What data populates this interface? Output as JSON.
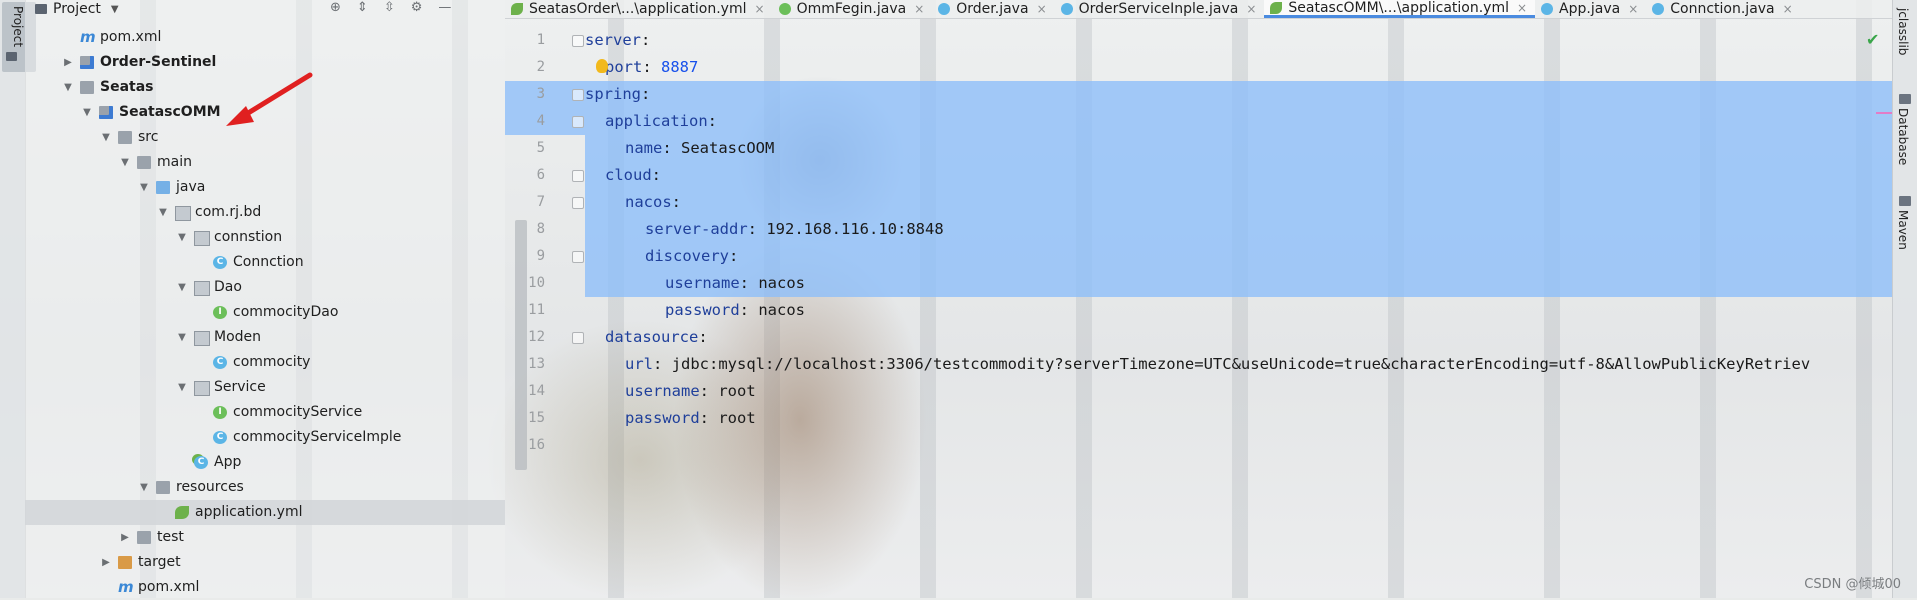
{
  "left_strip": {
    "project_tab": "Project"
  },
  "project": {
    "title": "Project",
    "tree": [
      {
        "label": "pom.xml",
        "icon": "maven-icon",
        "indent": 1,
        "arrow": "",
        "bold": false
      },
      {
        "label": "Order-Sentinel",
        "icon": "module-icon",
        "indent": 1,
        "arrow": "▶",
        "bold": true
      },
      {
        "label": "Seatas",
        "icon": "folder-icon",
        "indent": 1,
        "arrow": "▼",
        "bold": true
      },
      {
        "label": "SeatascOMM",
        "icon": "module-icon",
        "indent": 2,
        "arrow": "▼",
        "bold": true
      },
      {
        "label": "src",
        "icon": "folder-icon",
        "indent": 3,
        "arrow": "▼",
        "bold": false
      },
      {
        "label": "main",
        "icon": "folder-icon",
        "indent": 4,
        "arrow": "▼",
        "bold": false
      },
      {
        "label": "java",
        "icon": "folder-blue-icon",
        "indent": 5,
        "arrow": "▼",
        "bold": false
      },
      {
        "label": "com.rj.bd",
        "icon": "package-icon",
        "indent": 6,
        "arrow": "▼",
        "bold": false
      },
      {
        "label": "connstion",
        "icon": "package-icon",
        "indent": 7,
        "arrow": "▼",
        "bold": false
      },
      {
        "label": "Connction",
        "icon": "class-icon",
        "indent": 8,
        "arrow": "",
        "bold": false
      },
      {
        "label": "Dao",
        "icon": "package-icon",
        "indent": 7,
        "arrow": "▼",
        "bold": false
      },
      {
        "label": "commocityDao",
        "icon": "interface-icon",
        "indent": 8,
        "arrow": "",
        "bold": false
      },
      {
        "label": "Moden",
        "icon": "package-icon",
        "indent": 7,
        "arrow": "▼",
        "bold": false
      },
      {
        "label": "commocity",
        "icon": "class-icon",
        "indent": 8,
        "arrow": "",
        "bold": false
      },
      {
        "label": "Service",
        "icon": "package-icon",
        "indent": 7,
        "arrow": "▼",
        "bold": false
      },
      {
        "label": "commocityService",
        "icon": "interface-icon",
        "indent": 8,
        "arrow": "",
        "bold": false
      },
      {
        "label": "commocityServiceImple",
        "icon": "class-icon",
        "indent": 8,
        "arrow": "",
        "bold": false
      },
      {
        "label": "App",
        "icon": "app-icon",
        "indent": 7,
        "arrow": "",
        "bold": false
      },
      {
        "label": "resources",
        "icon": "folder-icon",
        "indent": 5,
        "arrow": "▼",
        "bold": false
      },
      {
        "label": "application.yml",
        "icon": "yml-icon",
        "indent": 6,
        "arrow": "",
        "bold": false,
        "selected": true
      },
      {
        "label": "test",
        "icon": "folder-icon",
        "indent": 4,
        "arrow": "▶",
        "bold": false
      },
      {
        "label": "target",
        "icon": "folder-orange-icon",
        "indent": 3,
        "arrow": "▶",
        "bold": false
      },
      {
        "label": "pom.xml",
        "icon": "maven-icon",
        "indent": 3,
        "arrow": "",
        "bold": false
      }
    ]
  },
  "tabs": [
    {
      "label": "SeatasOrder\\...\\application.yml",
      "icon": "yml",
      "active": false
    },
    {
      "label": "OmmFegin.java",
      "icon": "ifc",
      "active": false
    },
    {
      "label": "Order.java",
      "icon": "cls",
      "active": false
    },
    {
      "label": "OrderServiceInple.java",
      "icon": "cls",
      "active": false
    },
    {
      "label": "SeatascOMM\\...\\application.yml",
      "icon": "yml",
      "active": true
    },
    {
      "label": "App.java",
      "icon": "cls",
      "active": false
    },
    {
      "label": "Connction.java",
      "icon": "cls",
      "active": false
    }
  ],
  "code_lines": [
    {
      "num": "1",
      "indent": 0,
      "key": "server",
      "val": ""
    },
    {
      "num": "2",
      "indent": 1,
      "key": "port",
      "val": "8887",
      "num_val": true
    },
    {
      "num": "3",
      "indent": 0,
      "key": "spring",
      "val": ""
    },
    {
      "num": "4",
      "indent": 1,
      "key": "application",
      "val": ""
    },
    {
      "num": "5",
      "indent": 2,
      "key": "name",
      "val": "SeatascOOM"
    },
    {
      "num": "6",
      "indent": 1,
      "key": "cloud",
      "val": ""
    },
    {
      "num": "7",
      "indent": 2,
      "key": "nacos",
      "val": ""
    },
    {
      "num": "8",
      "indent": 3,
      "key": "server-addr",
      "val": "192.168.116.10:8848"
    },
    {
      "num": "9",
      "indent": 3,
      "key": "discovery",
      "val": ""
    },
    {
      "num": "10",
      "indent": 4,
      "key": "username",
      "val": "nacos"
    },
    {
      "num": "11",
      "indent": 4,
      "key": "password",
      "val": "nacos"
    },
    {
      "num": "12",
      "indent": 1,
      "key": "datasource",
      "val": ""
    },
    {
      "num": "13",
      "indent": 2,
      "key": "url",
      "val": "jdbc:mysql://localhost:3306/testcommodity?serverTimezone=UTC&useUnicode=true&characterEncoding=utf-8&AllowPublicKeyRetriev"
    },
    {
      "num": "14",
      "indent": 2,
      "key": "username",
      "val": "root"
    },
    {
      "num": "15",
      "indent": 2,
      "key": "password",
      "val": "root"
    },
    {
      "num": "16",
      "indent": 0,
      "key": "",
      "val": ""
    }
  ],
  "right_strip": {
    "items": [
      "jclasslib",
      "Database",
      "Maven"
    ]
  },
  "watermark": "CSDN @倾城00"
}
